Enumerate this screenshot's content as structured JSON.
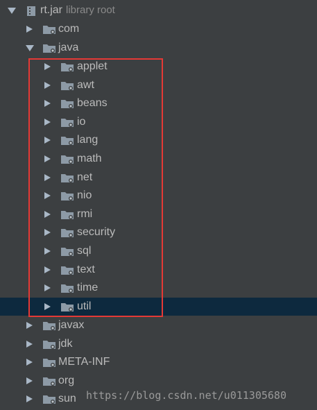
{
  "root": {
    "label": "rt.jar",
    "sublabel": "library root"
  },
  "top_packages": [
    {
      "label": "com"
    },
    {
      "label": "java"
    }
  ],
  "java_children": [
    {
      "label": "applet"
    },
    {
      "label": "awt"
    },
    {
      "label": "beans"
    },
    {
      "label": "io"
    },
    {
      "label": "lang"
    },
    {
      "label": "math"
    },
    {
      "label": "net"
    },
    {
      "label": "nio"
    },
    {
      "label": "rmi"
    },
    {
      "label": "security"
    },
    {
      "label": "sql"
    },
    {
      "label": "text"
    },
    {
      "label": "time"
    },
    {
      "label": "util"
    }
  ],
  "bottom_packages": [
    {
      "label": "javax"
    },
    {
      "label": "jdk"
    },
    {
      "label": "META-INF"
    },
    {
      "label": "org"
    },
    {
      "label": "sun"
    }
  ],
  "selected_item": "util",
  "watermark": "https://blog.csdn.net/u011305680",
  "icons": {
    "expanded": "triangle-down-icon",
    "collapsed": "triangle-right-icon",
    "package": "package-folder-icon",
    "jar": "jar-icon"
  },
  "colors": {
    "background": "#3c3f41",
    "selection": "#0d293e",
    "highlight_box": "#e53935",
    "text": "#bbbbbb"
  }
}
